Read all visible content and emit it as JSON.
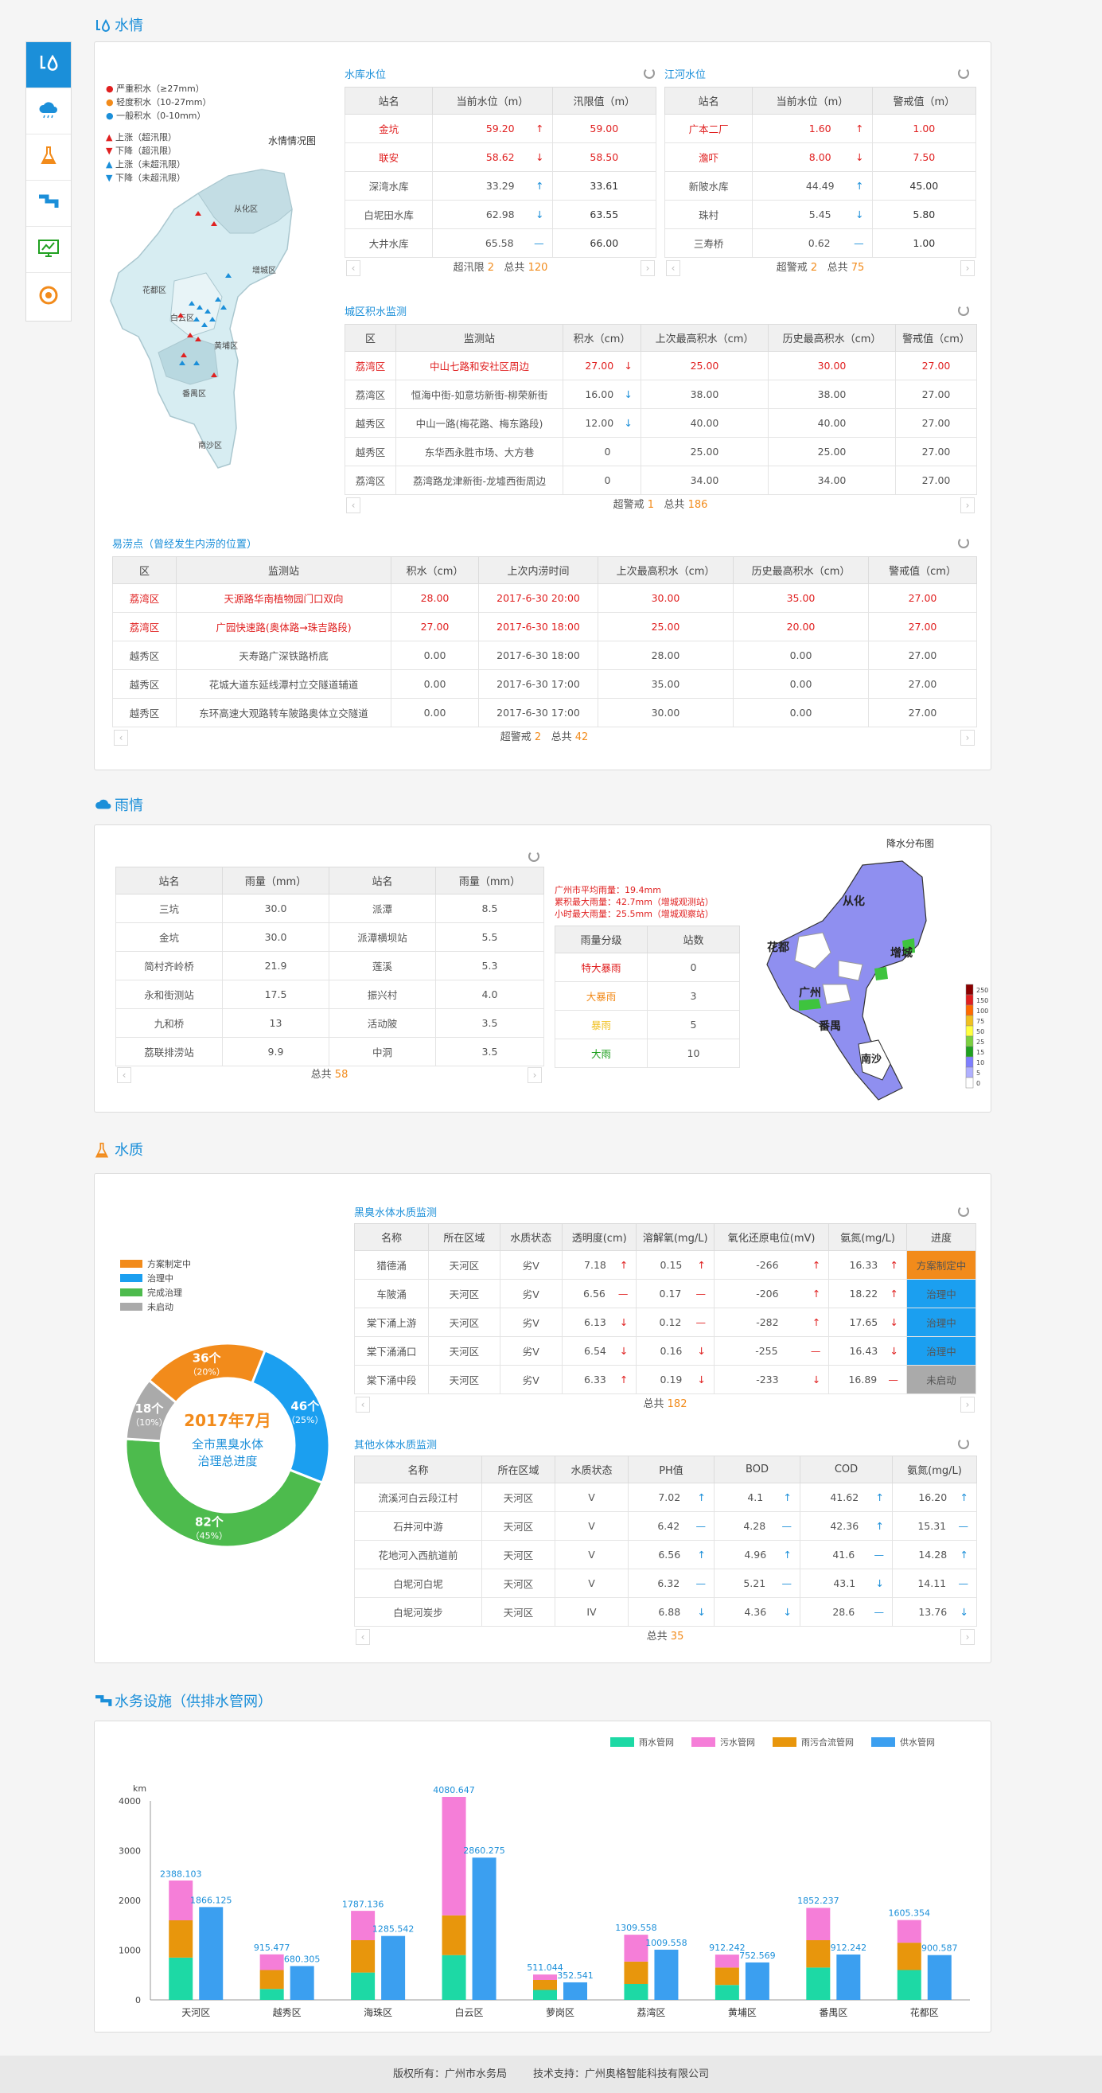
{
  "sections": {
    "water": "水情",
    "rain": "雨情",
    "quality": "水质",
    "facility": "水务设施（供排水管网）"
  },
  "sidebar": [
    "water",
    "rain",
    "quality",
    "facility",
    "monitor",
    "network"
  ],
  "map1": {
    "title": "水情情况图",
    "legend": [
      {
        "label": "严重积水（≥27mm）",
        "color": "#e02020"
      },
      {
        "label": "轻度积水（10-27mm）",
        "color": "#f28b1b"
      },
      {
        "label": "一般积水（0-10mm）",
        "color": "#1b8fd9"
      }
    ],
    "legend2": [
      {
        "label": "上涨（超汛限）",
        "color": "#e02020",
        "dir": "up"
      },
      {
        "label": "下降（超汛限）",
        "color": "#e02020",
        "dir": "down"
      },
      {
        "label": "上涨（未超汛限）",
        "color": "#1b8fd9",
        "dir": "up"
      },
      {
        "label": "下降（未超汛限）",
        "color": "#1b8fd9",
        "dir": "down"
      }
    ],
    "districts": [
      "从化区",
      "增城区",
      "花都区",
      "白云区",
      "黄埔区",
      "番禺区",
      "南沙区"
    ]
  },
  "reservoir": {
    "title": "水库水位",
    "headers": [
      "站名",
      "当前水位（m）",
      "汛限值（m）"
    ],
    "rows": [
      {
        "name": "金坑",
        "level": "59.20",
        "trend": "↑",
        "limit": "59.00",
        "red": true,
        "tc": "up"
      },
      {
        "name": "联安",
        "level": "58.62",
        "trend": "↓",
        "limit": "58.50",
        "red": true,
        "tc": "down"
      },
      {
        "name": "深湾水库",
        "level": "33.29",
        "trend": "↑",
        "limit": "33.61",
        "red": false,
        "tc": "up-b"
      },
      {
        "name": "白坭田水库",
        "level": "62.98",
        "trend": "↓",
        "limit": "63.55",
        "red": false,
        "tc": "down-b"
      },
      {
        "name": "大井水库",
        "level": "65.58",
        "trend": "—",
        "limit": "66.00",
        "red": false,
        "tc": "flat"
      }
    ],
    "pager": {
      "label1": "超汛限",
      "n1": "2",
      "label2": "总共",
      "n2": "120"
    }
  },
  "river": {
    "title": "江河水位",
    "headers": [
      "站名",
      "当前水位（m）",
      "警戒值（m）"
    ],
    "rows": [
      {
        "name": "广本二厂",
        "level": "1.60",
        "trend": "↑",
        "limit": "1.00",
        "red": true,
        "tc": "up"
      },
      {
        "name": "澹吓",
        "level": "8.00",
        "trend": "↓",
        "limit": "7.50",
        "red": true,
        "tc": "down"
      },
      {
        "name": "新陂水库",
        "level": "44.49",
        "trend": "↑",
        "limit": "45.00",
        "red": false,
        "tc": "up-b"
      },
      {
        "name": "珠村",
        "level": "5.45",
        "trend": "↓",
        "limit": "5.80",
        "red": false,
        "tc": "down-b"
      },
      {
        "name": "三寿桥",
        "level": "0.62",
        "trend": "—",
        "limit": "1.00",
        "red": false,
        "tc": "flat"
      }
    ],
    "pager": {
      "label1": "超警戒",
      "n1": "2",
      "label2": "总共",
      "n2": "75"
    }
  },
  "urban": {
    "title": "城区积水监测",
    "headers": [
      "区",
      "监测站",
      "积水（cm）",
      "上次最高积水（cm）",
      "历史最高积水（cm）",
      "警戒值（cm）"
    ],
    "rows": [
      {
        "d": "荔湾区",
        "s": "中山七路和安社区周边",
        "w": "27.00",
        "t": "↓",
        "tc": "down",
        "last": "25.00",
        "hist": "30.00",
        "warn": "27.00",
        "red": true
      },
      {
        "d": "荔湾区",
        "s": "恒海中街-如意坊新街-柳荣新街",
        "w": "16.00",
        "t": "↓",
        "tc": "down-b",
        "last": "38.00",
        "hist": "38.00",
        "warn": "27.00",
        "red": false
      },
      {
        "d": "越秀区",
        "s": "中山一路(梅花路、梅东路段)",
        "w": "12.00",
        "t": "↓",
        "tc": "down-b",
        "last": "40.00",
        "hist": "40.00",
        "warn": "27.00",
        "red": false
      },
      {
        "d": "越秀区",
        "s": "东华西永胜市场、大方巷",
        "w": "0",
        "t": "",
        "tc": "",
        "last": "25.00",
        "hist": "25.00",
        "warn": "27.00",
        "red": false
      },
      {
        "d": "荔湾区",
        "s": "荔湾路龙津新街-龙墟西街周边",
        "w": "0",
        "t": "",
        "tc": "",
        "last": "34.00",
        "hist": "34.00",
        "warn": "27.00",
        "red": false
      }
    ],
    "pager": {
      "label1": "超警戒",
      "n1": "1",
      "label2": "总共",
      "n2": "186"
    }
  },
  "flood": {
    "title": "易涝点（曾经发生内涝的位置）",
    "headers": [
      "区",
      "监测站",
      "积水（cm）",
      "上次内涝时间",
      "上次最高积水（cm）",
      "历史最高积水（cm）",
      "警戒值（cm）"
    ],
    "rows": [
      {
        "d": "荔湾区",
        "s": "天源路华南植物园门口双向",
        "w": "28.00",
        "time": "2017-6-30  20:00",
        "last": "30.00",
        "hist": "35.00",
        "warn": "27.00",
        "red": true
      },
      {
        "d": "荔湾区",
        "s": "广园快速路(奥体路→珠吉路段)",
        "w": "27.00",
        "time": "2017-6-30  18:00",
        "last": "25.00",
        "hist": "20.00",
        "warn": "27.00",
        "red": true
      },
      {
        "d": "越秀区",
        "s": "天寿路广深铁路桥底",
        "w": "0.00",
        "time": "2017-6-30  18:00",
        "last": "28.00",
        "hist": "0.00",
        "warn": "27.00",
        "red": false
      },
      {
        "d": "越秀区",
        "s": "花城大道东延线潭村立交隧道辅道",
        "w": "0.00",
        "time": "2017-6-30  17:00",
        "last": "35.00",
        "hist": "0.00",
        "warn": "27.00",
        "red": false
      },
      {
        "d": "越秀区",
        "s": "东环高速大观路转车陂路奥体立交隧道",
        "w": "0.00",
        "time": "2017-6-30  17:00",
        "last": "30.00",
        "hist": "0.00",
        "warn": "27.00",
        "red": false
      }
    ],
    "pager": {
      "label1": "超警戒",
      "n1": "2",
      "label2": "总共",
      "n2": "42"
    }
  },
  "rainTable": {
    "headers": [
      "站名",
      "雨量（mm）",
      "站名",
      "雨量（mm）"
    ],
    "rows": [
      [
        "三坑",
        "30.0",
        "派潭",
        "8.5"
      ],
      [
        "金坑",
        "30.0",
        "派潭横坝站",
        "5.5"
      ],
      [
        "简村齐岭桥",
        "21.9",
        "莲溪",
        "5.3"
      ],
      [
        "永和街测站",
        "17.5",
        "振兴村",
        "4.0"
      ],
      [
        "九和桥",
        "13",
        "活动陂",
        "3.5"
      ],
      [
        "荔联排涝站",
        "9.9",
        "中洞",
        "3.5"
      ]
    ],
    "pager": {
      "label2": "总共",
      "n2": "58"
    }
  },
  "rainInfo": {
    "l1": "广州市平均雨量：19.4mm",
    "l2": "累积最大雨量：42.7mm（增城观测站）",
    "l3": "小时最大雨量：25.5mm（增城观察站）"
  },
  "rainLevel": {
    "headers": [
      "雨量分级",
      "站数"
    ],
    "rows": [
      {
        "g": "特大暴雨",
        "n": "0",
        "c": "#e02020"
      },
      {
        "g": "大暴雨",
        "n": "3",
        "c": "#f28b1b"
      },
      {
        "g": "暴雨",
        "n": "5",
        "c": "#f0c020"
      },
      {
        "g": "大雨",
        "n": "10",
        "c": "#20a020"
      }
    ]
  },
  "rainMap": {
    "title": "降水分布图",
    "labels": [
      "从化",
      "花都",
      "增城",
      "广州",
      "番禺",
      "南沙"
    ],
    "scale": [
      "250",
      "150",
      "100",
      "75",
      "50",
      "25",
      "15",
      "10",
      "5",
      "0"
    ],
    "scaleColors": [
      "#8b0000",
      "#e02020",
      "#ff6a00",
      "#f0c020",
      "#ffff40",
      "#7cd040",
      "#20a020",
      "#7f7fff",
      "#b0b0ff",
      "#ffffff"
    ]
  },
  "donut": {
    "legend": [
      {
        "label": "方案制定中",
        "color": "#f28b1b"
      },
      {
        "label": "治理中",
        "color": "#1b9ff0"
      },
      {
        "label": "完成治理",
        "color": "#4dbb4d"
      },
      {
        "label": "未启动",
        "color": "#aaaaaa"
      }
    ],
    "segments": [
      {
        "n": "36个",
        "p": "（20%）",
        "frac": 0.2,
        "color": "#f28b1b"
      },
      {
        "n": "46个",
        "p": "（25%）",
        "frac": 0.25,
        "color": "#1b9ff0"
      },
      {
        "n": "82个",
        "p": "（45%）",
        "frac": 0.45,
        "color": "#4dbb4d"
      },
      {
        "n": "18个",
        "p": "（10%）",
        "frac": 0.1,
        "color": "#aaaaaa"
      }
    ],
    "center1": "2017年7月",
    "center2": "全市黑臭水体",
    "center3": "治理总进度"
  },
  "blackWater": {
    "title": "黑臭水体水质监测",
    "headers": [
      "名称",
      "所在区域",
      "水质状态",
      "透明度(cm)",
      "溶解氧(mg/L)",
      "氧化还原电位(mV)",
      "氨氮(mg/L)",
      "进度"
    ],
    "rows": [
      {
        "n": "猎德涌",
        "a": "天河区",
        "s": "劣V",
        "t": "7.18",
        "ta": "↑",
        "o": "0.15",
        "oa": "↑",
        "r": "-266",
        "ra": "↑",
        "nh": "16.33",
        "na": "↑",
        "p": "方案制定中",
        "pc": "#f28b1b"
      },
      {
        "n": "车陂涌",
        "a": "天河区",
        "s": "劣V",
        "t": "6.56",
        "ta": "—",
        "o": "0.17",
        "oa": "—",
        "r": "-206",
        "ra": "↑",
        "nh": "18.22",
        "na": "↑",
        "p": "治理中",
        "pc": "#1b9ff0"
      },
      {
        "n": "棠下涌上游",
        "a": "天河区",
        "s": "劣V",
        "t": "6.13",
        "ta": "↓",
        "o": "0.12",
        "oa": "—",
        "r": "-282",
        "ra": "↑",
        "nh": "17.65",
        "na": "↓",
        "p": "治理中",
        "pc": "#1b9ff0"
      },
      {
        "n": "棠下涌涌口",
        "a": "天河区",
        "s": "劣V",
        "t": "6.54",
        "ta": "↓",
        "o": "0.16",
        "oa": "↓",
        "r": "-255",
        "ra": "—",
        "nh": "16.43",
        "na": "↓",
        "p": "治理中",
        "pc": "#1b9ff0"
      },
      {
        "n": "棠下涌中段",
        "a": "天河区",
        "s": "劣V",
        "t": "6.33",
        "ta": "↑",
        "o": "0.19",
        "oa": "↓",
        "r": "-233",
        "ra": "↓",
        "nh": "16.89",
        "na": "—",
        "p": "未启动",
        "pc": "#aaaaaa"
      }
    ],
    "pager": {
      "label2": "总共",
      "n2": "182"
    }
  },
  "otherWater": {
    "title": "其他水体水质监测",
    "headers": [
      "名称",
      "所在区域",
      "水质状态",
      "PH值",
      "BOD",
      "COD",
      "氨氮(mg/L)"
    ],
    "rows": [
      {
        "n": "流溪河白云段江村",
        "a": "天河区",
        "s": "V",
        "ph": "7.02",
        "pa": "↑",
        "b": "4.1",
        "ba": "↑",
        "c": "41.62",
        "ca": "↑",
        "nh": "16.20",
        "na": "↑"
      },
      {
        "n": "石井河中游",
        "a": "天河区",
        "s": "V",
        "ph": "6.42",
        "pa": "—",
        "b": "4.28",
        "ba": "—",
        "c": "42.36",
        "ca": "↑",
        "nh": "15.31",
        "na": "—"
      },
      {
        "n": "花地河入西航道前",
        "a": "天河区",
        "s": "V",
        "ph": "6.56",
        "pa": "↑",
        "b": "4.96",
        "ba": "↑",
        "c": "41.6",
        "ca": "—",
        "nh": "14.28",
        "na": "↑"
      },
      {
        "n": "白坭河白坭",
        "a": "天河区",
        "s": "V",
        "ph": "6.32",
        "pa": "—",
        "b": "5.21",
        "ba": "—",
        "c": "43.1",
        "ca": "↓",
        "nh": "14.11",
        "na": "—"
      },
      {
        "n": "白坭河炭步",
        "a": "天河区",
        "s": "IV",
        "ph": "6.88",
        "pa": "↓",
        "b": "4.36",
        "ba": "↓",
        "c": "28.6",
        "ca": "—",
        "nh": "13.76",
        "na": "↓"
      }
    ],
    "pager": {
      "label2": "总共",
      "n2": "35"
    }
  },
  "chart_data": {
    "type": "bar",
    "ylabel": "km",
    "ylim": [
      0,
      4000
    ],
    "yticks": [
      0,
      1000,
      2000,
      3000,
      4000
    ],
    "categories": [
      "天河区",
      "越秀区",
      "海珠区",
      "白云区",
      "萝岗区",
      "荔湾区",
      "黄埔区",
      "番禺区",
      "花都区"
    ],
    "series": [
      {
        "name": "雨水管网",
        "color": "#1dd9a5"
      },
      {
        "name": "污水管网",
        "color": "#f57ed8"
      },
      {
        "name": "雨污合流管网",
        "color": "#e8960c"
      },
      {
        "name": "供水管网",
        "color": "#3b9ff0"
      }
    ],
    "stacked_totals": [
      2388.103,
      915.477,
      1787.136,
      4080.647,
      511.044,
      1309.558,
      912.242,
      1852.237,
      1605.354
    ],
    "stack_parts": [
      [
        850,
        750,
        800
      ],
      [
        220,
        380,
        315
      ],
      [
        550,
        650,
        590
      ],
      [
        900,
        800,
        2380
      ],
      [
        200,
        200,
        110
      ],
      [
        320,
        450,
        540
      ],
      [
        300,
        350,
        260
      ],
      [
        650,
        550,
        650
      ],
      [
        600,
        550,
        455
      ]
    ],
    "supply": [
      1866.125,
      680.305,
      1285.542,
      2860.275,
      352.541,
      1009.558,
      752.569,
      912.242,
      900.587
    ]
  },
  "footer": {
    "copyright": "版权所有：广州市水务局",
    "support": "技术支持：广州奥格智能科技有限公司"
  }
}
